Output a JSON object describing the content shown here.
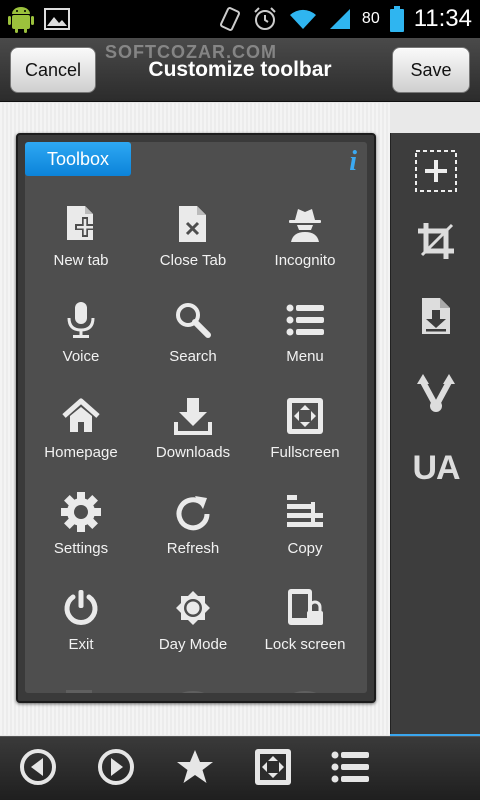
{
  "status_bar": {
    "battery_text": "80",
    "time": "11:34"
  },
  "header": {
    "cancel_label": "Cancel",
    "title": "Customize toolbar",
    "save_label": "Save",
    "watermark": "SOFTCOZAR.COM"
  },
  "toolbox": {
    "tab_label": "Toolbox",
    "info_glyph": "i",
    "items": [
      {
        "label": "New tab",
        "icon": "new-tab-icon"
      },
      {
        "label": "Close Tab",
        "icon": "close-tab-icon"
      },
      {
        "label": "Incognito",
        "icon": "incognito-icon"
      },
      {
        "label": "Voice",
        "icon": "microphone-icon"
      },
      {
        "label": "Search",
        "icon": "search-icon"
      },
      {
        "label": "Menu",
        "icon": "menu-list-icon"
      },
      {
        "label": "Homepage",
        "icon": "home-icon"
      },
      {
        "label": "Downloads",
        "icon": "download-icon"
      },
      {
        "label": "Fullscreen",
        "icon": "fullscreen-icon"
      },
      {
        "label": "Settings",
        "icon": "gear-icon"
      },
      {
        "label": "Refresh",
        "icon": "refresh-icon"
      },
      {
        "label": "Copy",
        "icon": "copy-icon"
      },
      {
        "label": "Exit",
        "icon": "power-icon"
      },
      {
        "label": "Day Mode",
        "icon": "brightness-icon"
      },
      {
        "label": "Lock screen",
        "icon": "lock-screen-icon"
      }
    ]
  },
  "right_strip": {
    "items": [
      "add-slot-icon",
      "crop-icon",
      "save-page-icon",
      "branch-icon"
    ],
    "ua_label": "UA"
  },
  "bottom_bar": {
    "items": [
      "back-icon",
      "forward-icon",
      "star-icon",
      "fullscreen-icon",
      "menu-list-icon"
    ]
  },
  "colors": {
    "accent_blue": "#0c83d9",
    "panel_dark": "#3a3a3a",
    "icon_fill": "#eaeaea"
  }
}
